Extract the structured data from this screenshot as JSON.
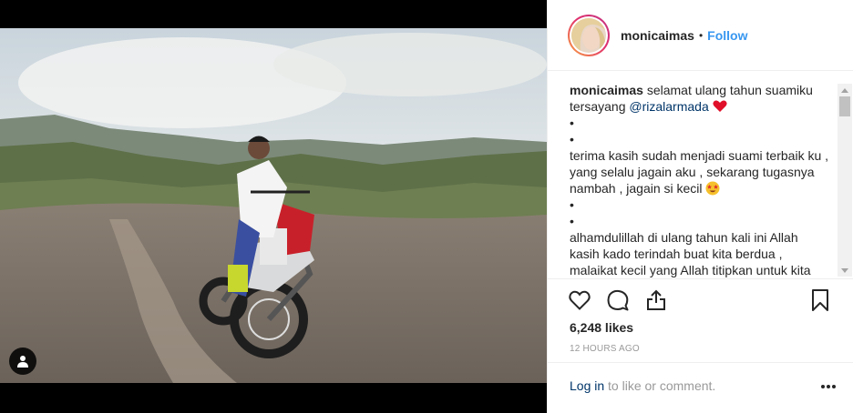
{
  "post": {
    "username": "monicaimas",
    "follow_label": "Follow",
    "separator": "•",
    "caption": {
      "username": "monicaimas",
      "text_line1": " selamat ulang tahun suamiku",
      "text_line2": "tersayang ",
      "mention": "@rizalarmada",
      "heart": "❤️",
      "bullet": "•",
      "para1": "terima kasih sudah menjadi suami terbaik ku , yang selalu jagain aku , sekarang tugasnya nambah , jagain si kecil",
      "emoji": "😍",
      "para2": "alhamdulillah di ulang tahun kali ini Allah kasih kado terindah buat kita berdua , malaikat kecil yang Allah titipkan untuk kita"
    },
    "likes": "6,248 likes",
    "time": "12 HOURS AGO",
    "comment": {
      "login_label": "Log in",
      "rest": " to like or comment."
    }
  },
  "icons": {
    "like": "heart-icon",
    "comment": "comment-icon",
    "share": "share-icon",
    "save": "bookmark-icon",
    "more": "more-icon",
    "user_tag": "person-icon"
  },
  "colors": {
    "follow": "#3897f0",
    "mention": "#003569",
    "heart": "#ed4956"
  }
}
